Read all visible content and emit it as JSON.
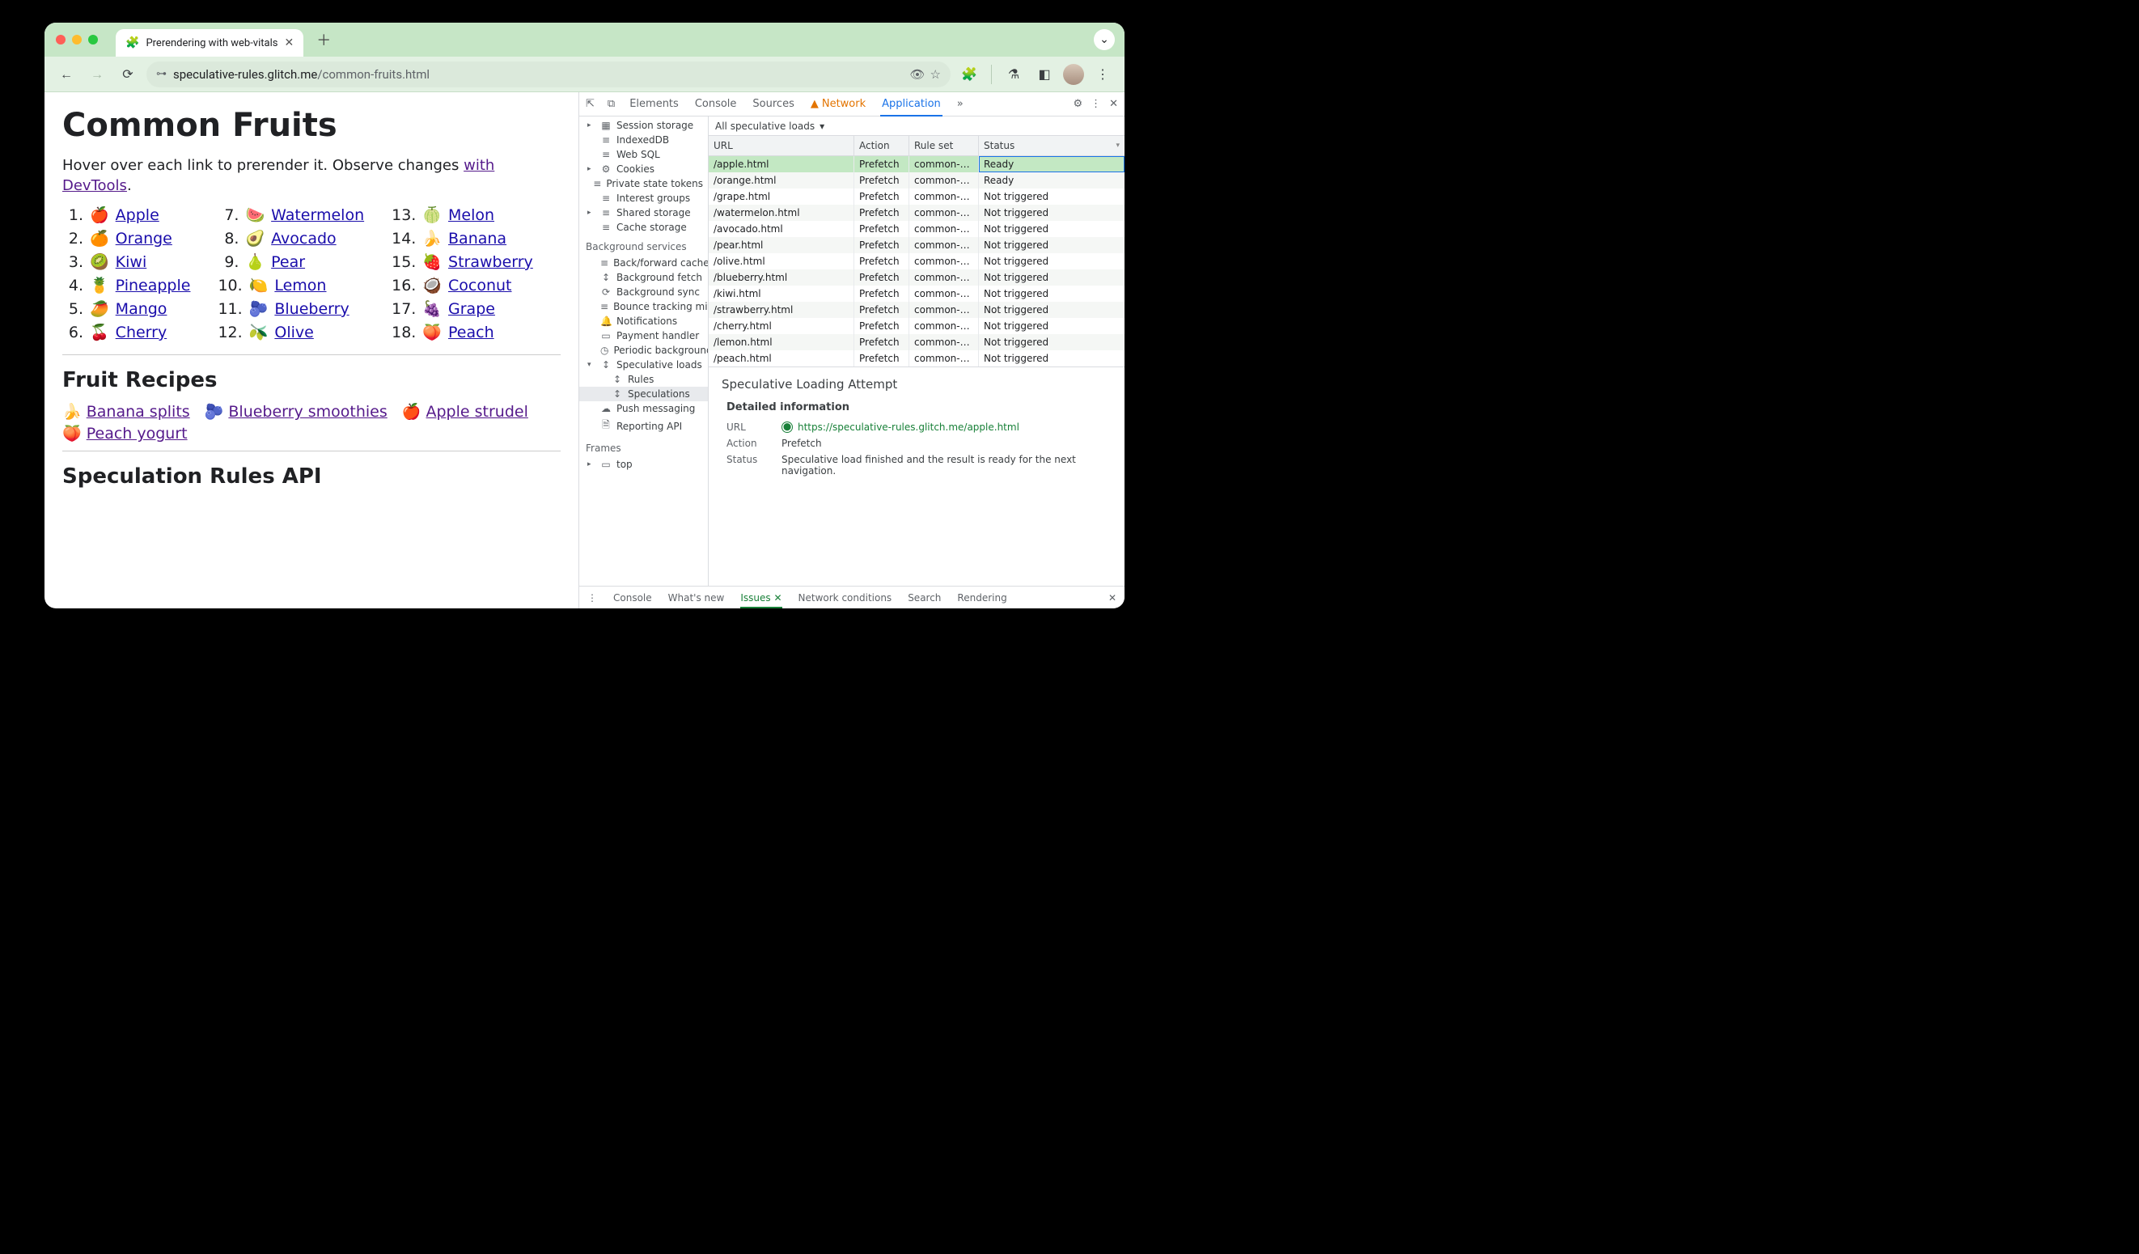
{
  "browser": {
    "tab": {
      "title": "Prerendering with web-vitals",
      "favicon": "🧩"
    },
    "url_host": "speculative-rules.glitch.me",
    "url_path": "/common-fruits.html"
  },
  "page": {
    "h1": "Common Fruits",
    "intro_pre": "Hover over each link to prerender it. Observe changes ",
    "intro_link": "with DevTools",
    "intro_post": ".",
    "fruits": [
      {
        "n": "1.",
        "e": "🍎",
        "t": "Apple"
      },
      {
        "n": "2.",
        "e": "🍊",
        "t": "Orange"
      },
      {
        "n": "3.",
        "e": "🥝",
        "t": "Kiwi"
      },
      {
        "n": "4.",
        "e": "🍍",
        "t": "Pineapple"
      },
      {
        "n": "5.",
        "e": "🥭",
        "t": "Mango"
      },
      {
        "n": "6.",
        "e": "🍒",
        "t": "Cherry"
      },
      {
        "n": "7.",
        "e": "🍉",
        "t": "Watermelon"
      },
      {
        "n": "8.",
        "e": "🥑",
        "t": "Avocado"
      },
      {
        "n": "9.",
        "e": "🍐",
        "t": "Pear"
      },
      {
        "n": "10.",
        "e": "🍋",
        "t": "Lemon"
      },
      {
        "n": "11.",
        "e": "🫐",
        "t": "Blueberry"
      },
      {
        "n": "12.",
        "e": "🫒",
        "t": "Olive"
      },
      {
        "n": "13.",
        "e": "🍈",
        "t": "Melon"
      },
      {
        "n": "14.",
        "e": "🍌",
        "t": "Banana"
      },
      {
        "n": "15.",
        "e": "🍓",
        "t": "Strawberry"
      },
      {
        "n": "16.",
        "e": "🥥",
        "t": "Coconut"
      },
      {
        "n": "17.",
        "e": "🍇",
        "t": "Grape"
      },
      {
        "n": "18.",
        "e": "🍑",
        "t": "Peach"
      }
    ],
    "h2_recipes": "Fruit Recipes",
    "recipes": [
      {
        "e": "🍌",
        "t": "Banana splits"
      },
      {
        "e": "🫐",
        "t": "Blueberry smoothies"
      },
      {
        "e": "🍎",
        "t": "Apple strudel"
      },
      {
        "e": "🍑",
        "t": "Peach yogurt"
      }
    ],
    "h2_api": "Speculation Rules API"
  },
  "devtools": {
    "tabs": [
      "Elements",
      "Console",
      "Sources",
      "Network",
      "Application"
    ],
    "more": "»",
    "tree": {
      "storage": [
        {
          "g": "▸",
          "i": "▦",
          "t": "Session storage"
        },
        {
          "g": "",
          "i": "≡",
          "t": "IndexedDB"
        },
        {
          "g": "",
          "i": "≡",
          "t": "Web SQL"
        },
        {
          "g": "▸",
          "i": "⚙",
          "t": "Cookies"
        },
        {
          "g": "",
          "i": "≡",
          "t": "Private state tokens"
        },
        {
          "g": "",
          "i": "≡",
          "t": "Interest groups"
        },
        {
          "g": "▸",
          "i": "≡",
          "t": "Shared storage"
        },
        {
          "g": "",
          "i": "≡",
          "t": "Cache storage"
        }
      ],
      "bg_header": "Background services",
      "bg": [
        {
          "i": "≡",
          "t": "Back/forward cache"
        },
        {
          "i": "↕",
          "t": "Background fetch"
        },
        {
          "i": "⟳",
          "t": "Background sync"
        },
        {
          "i": "≡",
          "t": "Bounce tracking mitigation"
        },
        {
          "i": "🔔",
          "t": "Notifications"
        },
        {
          "i": "▭",
          "t": "Payment handler"
        },
        {
          "i": "◷",
          "t": "Periodic background sync"
        }
      ],
      "spec_parent": "Speculative loads",
      "spec_children": [
        "Rules",
        "Speculations"
      ],
      "bg2": [
        {
          "i": "☁",
          "t": "Push messaging"
        },
        {
          "i": "🗎",
          "t": "Reporting API"
        }
      ],
      "frames_header": "Frames",
      "frames_top": "top"
    },
    "filter": "All speculative loads",
    "columns": [
      "URL",
      "Action",
      "Rule set",
      "Status"
    ],
    "rows": [
      {
        "url": "/apple.html",
        "action": "Prefetch",
        "ruleset": "common-…",
        "status": "Ready",
        "sel": true
      },
      {
        "url": "/orange.html",
        "action": "Prefetch",
        "ruleset": "common-…",
        "status": "Ready"
      },
      {
        "url": "/grape.html",
        "action": "Prefetch",
        "ruleset": "common-…",
        "status": "Not triggered"
      },
      {
        "url": "/watermelon.html",
        "action": "Prefetch",
        "ruleset": "common-…",
        "status": "Not triggered"
      },
      {
        "url": "/avocado.html",
        "action": "Prefetch",
        "ruleset": "common-…",
        "status": "Not triggered"
      },
      {
        "url": "/pear.html",
        "action": "Prefetch",
        "ruleset": "common-…",
        "status": "Not triggered"
      },
      {
        "url": "/olive.html",
        "action": "Prefetch",
        "ruleset": "common-…",
        "status": "Not triggered"
      },
      {
        "url": "/blueberry.html",
        "action": "Prefetch",
        "ruleset": "common-…",
        "status": "Not triggered"
      },
      {
        "url": "/kiwi.html",
        "action": "Prefetch",
        "ruleset": "common-…",
        "status": "Not triggered"
      },
      {
        "url": "/strawberry.html",
        "action": "Prefetch",
        "ruleset": "common-…",
        "status": "Not triggered"
      },
      {
        "url": "/cherry.html",
        "action": "Prefetch",
        "ruleset": "common-…",
        "status": "Not triggered"
      },
      {
        "url": "/lemon.html",
        "action": "Prefetch",
        "ruleset": "common-…",
        "status": "Not triggered"
      },
      {
        "url": "/peach.html",
        "action": "Prefetch",
        "ruleset": "common-…",
        "status": "Not triggered"
      }
    ],
    "detail": {
      "title": "Speculative Loading Attempt",
      "subhead": "Detailed information",
      "url_label": "URL",
      "url_value": "https://speculative-rules.glitch.me/apple.html",
      "action_label": "Action",
      "action_value": "Prefetch",
      "status_label": "Status",
      "status_value": "Speculative load finished and the result is ready for the next navigation."
    },
    "drawer": [
      "Console",
      "What's new",
      "Issues",
      "Network conditions",
      "Search",
      "Rendering"
    ]
  }
}
